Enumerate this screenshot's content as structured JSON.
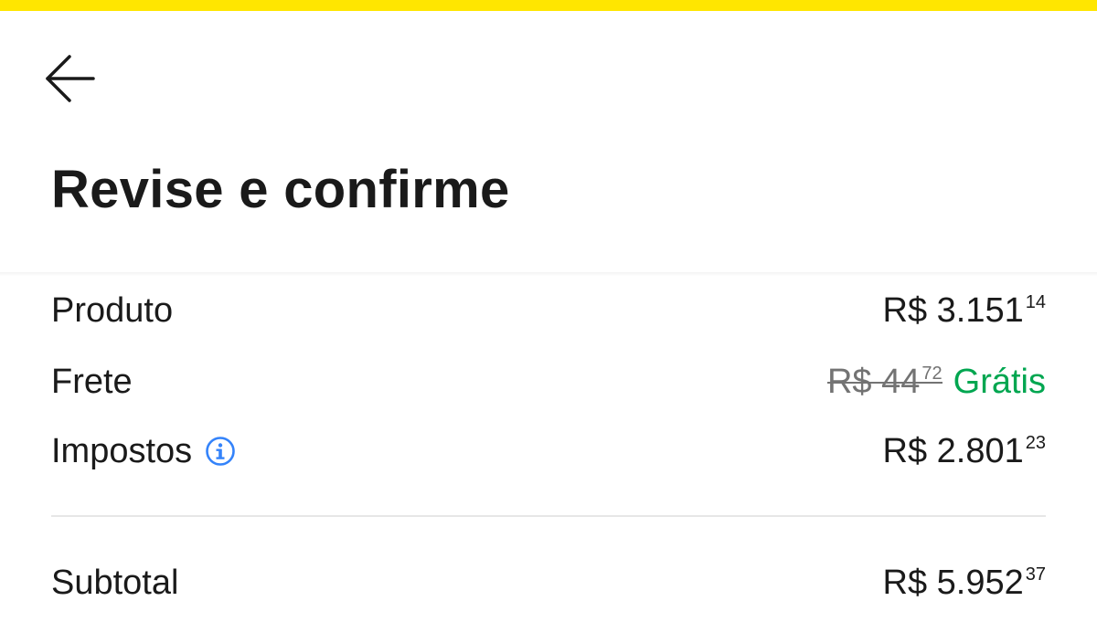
{
  "header": {
    "back_icon": "arrow-left-icon",
    "title": "Revise e confirme"
  },
  "summary": {
    "product": {
      "label": "Produto",
      "price_main": "R$ 3.151",
      "price_cents": "14"
    },
    "shipping": {
      "label": "Frete",
      "old_price_main": "R$ 44",
      "old_price_cents": "72",
      "free_label": "Grátis"
    },
    "taxes": {
      "label": "Impostos",
      "info_icon": "info-icon",
      "price_main": "R$ 2.801",
      "price_cents": "23"
    },
    "subtotal": {
      "label": "Subtotal",
      "price_main": "R$ 5.952",
      "price_cents": "37"
    }
  },
  "colors": {
    "accent_yellow": "#ffe600",
    "free_green": "#00a650",
    "info_blue": "#3483fa",
    "text": "#1a1a1a",
    "muted": "#737373"
  }
}
